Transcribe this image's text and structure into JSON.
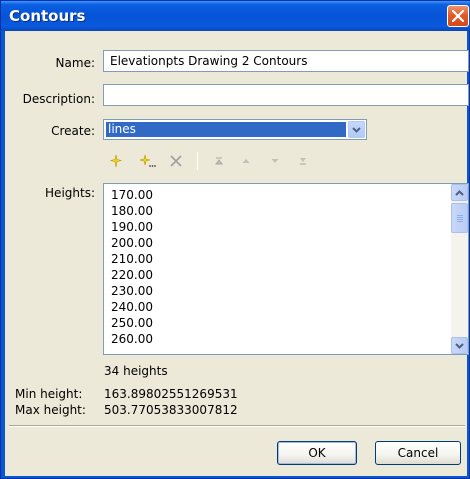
{
  "window": {
    "title": "Contours"
  },
  "form": {
    "name_label": "Name:",
    "name_value": "Elevationpts Drawing 2 Contours",
    "description_label": "Description:",
    "description_value": "",
    "create_label": "Create:",
    "create_value": "lines",
    "heights_label": "Heights:",
    "heights": [
      "170.00",
      "180.00",
      "190.00",
      "200.00",
      "210.00",
      "220.00",
      "230.00",
      "240.00",
      "250.00",
      "260.00"
    ],
    "heights_count": "34 heights",
    "min_height_label": "Min height:",
    "min_height_value": "163.89802551269531",
    "max_height_label": "Max height:",
    "max_height_value": "503.77053833007812"
  },
  "toolbar": {
    "icons": [
      "add-icon",
      "add-multiple-icon",
      "delete-icon",
      "move-top-icon",
      "move-up-icon",
      "move-down-icon",
      "move-bottom-icon"
    ]
  },
  "buttons": {
    "ok_label": "OK",
    "cancel_label": "Cancel"
  },
  "colors": {
    "titlebar": "#0653d8",
    "dialog_bg": "#ece9d8",
    "selection": "#316ac5",
    "close": "#e35a28"
  }
}
